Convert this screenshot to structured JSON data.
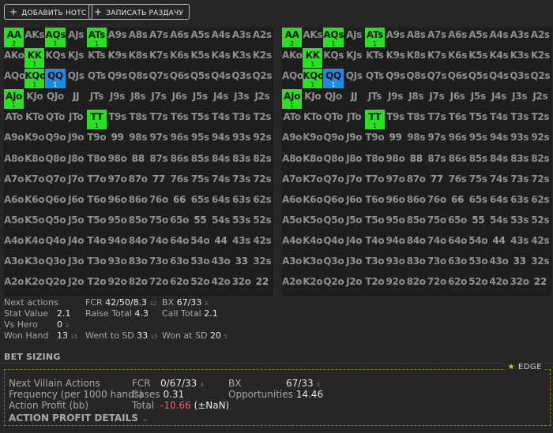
{
  "toolbar": {
    "add_notes_label": "ДОБАВИТЬ НОТС",
    "record_hand_label": "ЗАПИСАТЬ РАЗДАЧУ"
  },
  "grids": [
    {
      "rows": [
        [
          "AA",
          "AKs",
          "AQs",
          "AJs",
          "ATs",
          "A9s",
          "A8s",
          "A7s",
          "A6s",
          "A5s",
          "A4s",
          "A3s",
          "A2s"
        ],
        [
          "AKo",
          "KK",
          "KQs",
          "KJs",
          "KTs",
          "K9s",
          "K8s",
          "K7s",
          "K6s",
          "K5s",
          "K4s",
          "K3s",
          "K2s"
        ],
        [
          "AQo",
          "KQo",
          "QQ",
          "QJs",
          "QTs",
          "Q9s",
          "Q8s",
          "Q7s",
          "Q6s",
          "Q5s",
          "Q4s",
          "Q3s",
          "Q2s"
        ],
        [
          "AJo",
          "KJo",
          "QJo",
          "JJ",
          "JTs",
          "J9s",
          "J8s",
          "J7s",
          "J6s",
          "J5s",
          "J4s",
          "J3s",
          "J2s"
        ],
        [
          "ATo",
          "KTo",
          "QTo",
          "JTo",
          "TT",
          "T9s",
          "T8s",
          "T7s",
          "T6s",
          "T5s",
          "T4s",
          "T3s",
          "T2s"
        ],
        [
          "A9o",
          "K9o",
          "Q9o",
          "J9o",
          "T9o",
          "99",
          "98s",
          "97s",
          "96s",
          "95s",
          "94s",
          "93s",
          "92s"
        ],
        [
          "A8o",
          "K8o",
          "Q8o",
          "J8o",
          "T8o",
          "98o",
          "88",
          "87s",
          "86s",
          "85s",
          "84s",
          "83s",
          "82s"
        ],
        [
          "A7o",
          "K7o",
          "Q7o",
          "J7o",
          "T7o",
          "97o",
          "87o",
          "77",
          "76s",
          "75s",
          "74s",
          "73s",
          "72s"
        ],
        [
          "A6o",
          "K6o",
          "Q6o",
          "J6o",
          "T6o",
          "96o",
          "86o",
          "76o",
          "66",
          "65s",
          "64s",
          "63s",
          "62s"
        ],
        [
          "A5o",
          "K5o",
          "Q5o",
          "J5o",
          "T5o",
          "95o",
          "85o",
          "75o",
          "65o",
          "55",
          "54s",
          "53s",
          "52s"
        ],
        [
          "A4o",
          "K4o",
          "Q4o",
          "J4o",
          "T4o",
          "94o",
          "84o",
          "74o",
          "64o",
          "54o",
          "44",
          "43s",
          "42s"
        ],
        [
          "A3o",
          "K3o",
          "Q3o",
          "J3o",
          "T3o",
          "93o",
          "83o",
          "73o",
          "63o",
          "53o",
          "43o",
          "33",
          "32s"
        ],
        [
          "A2o",
          "K2o",
          "Q2o",
          "J2o",
          "T2o",
          "92o",
          "82o",
          "72o",
          "62o",
          "52o",
          "42o",
          "32o",
          "22"
        ]
      ],
      "highlights": [
        {
          "r": 0,
          "c": 0,
          "color": "green",
          "count": "2"
        },
        {
          "r": 0,
          "c": 2,
          "color": "green",
          "count": "1"
        },
        {
          "r": 0,
          "c": 4,
          "color": "green",
          "count": "1"
        },
        {
          "r": 1,
          "c": 1,
          "color": "green",
          "count": "1"
        },
        {
          "r": 2,
          "c": 1,
          "color": "green",
          "count": "1"
        },
        {
          "r": 2,
          "c": 2,
          "color": "blue",
          "count": "1"
        },
        {
          "r": 3,
          "c": 0,
          "color": "green",
          "count": "1"
        },
        {
          "r": 4,
          "c": 4,
          "color": "green",
          "count": "1"
        }
      ]
    }
  ],
  "stats": {
    "next_actions_label": "Next actions",
    "fcr_label": "FCR",
    "fcr_value": "42/50/8.3",
    "fcr_sub": "12",
    "bx_label": "BX",
    "bx_value": "67/33",
    "bx_sub": "3",
    "stat_value_label": "Stat Value",
    "stat_value": "2.1",
    "raise_total_label": "Raise Total",
    "raise_total_value": "4.3",
    "call_total_label": "Call Total",
    "call_total_value": "2.1",
    "vs_hero_label": "Vs Hero",
    "vs_hero_value": "0",
    "vs_hero_sub": "3",
    "won_hand_label": "Won Hand",
    "won_hand_value": "13",
    "won_hand_sub": "15",
    "went_to_sd_label": "Went to SD",
    "went_to_sd_value": "33",
    "went_to_sd_sub": "15",
    "won_at_sd_label": "Won at SD",
    "won_at_sd_value": "20",
    "won_at_sd_sub": "5"
  },
  "bet_sizing": {
    "title": "BET SIZING"
  },
  "edge": {
    "label": "EDGE",
    "next_villain_label": "Next Villain Actions",
    "frequency_label": "Frequency (per 1000 hands)",
    "action_profit_label": "Action Profit (bb)",
    "details_label": "ACTION PROFIT DETAILS",
    "fcr_label": "FCR",
    "fcr_value": "0/67/33",
    "fcr_sub": "3",
    "bx_label": "BX",
    "bx_value": "67/33",
    "bx_sub": "3",
    "cases_label": "Cases",
    "cases_value": "0.31",
    "opportunities_label": "Opportunities",
    "opportunities_value": "14.46",
    "total_label": "Total",
    "total_value": "-10.66",
    "total_extra": "(±NaN)"
  }
}
